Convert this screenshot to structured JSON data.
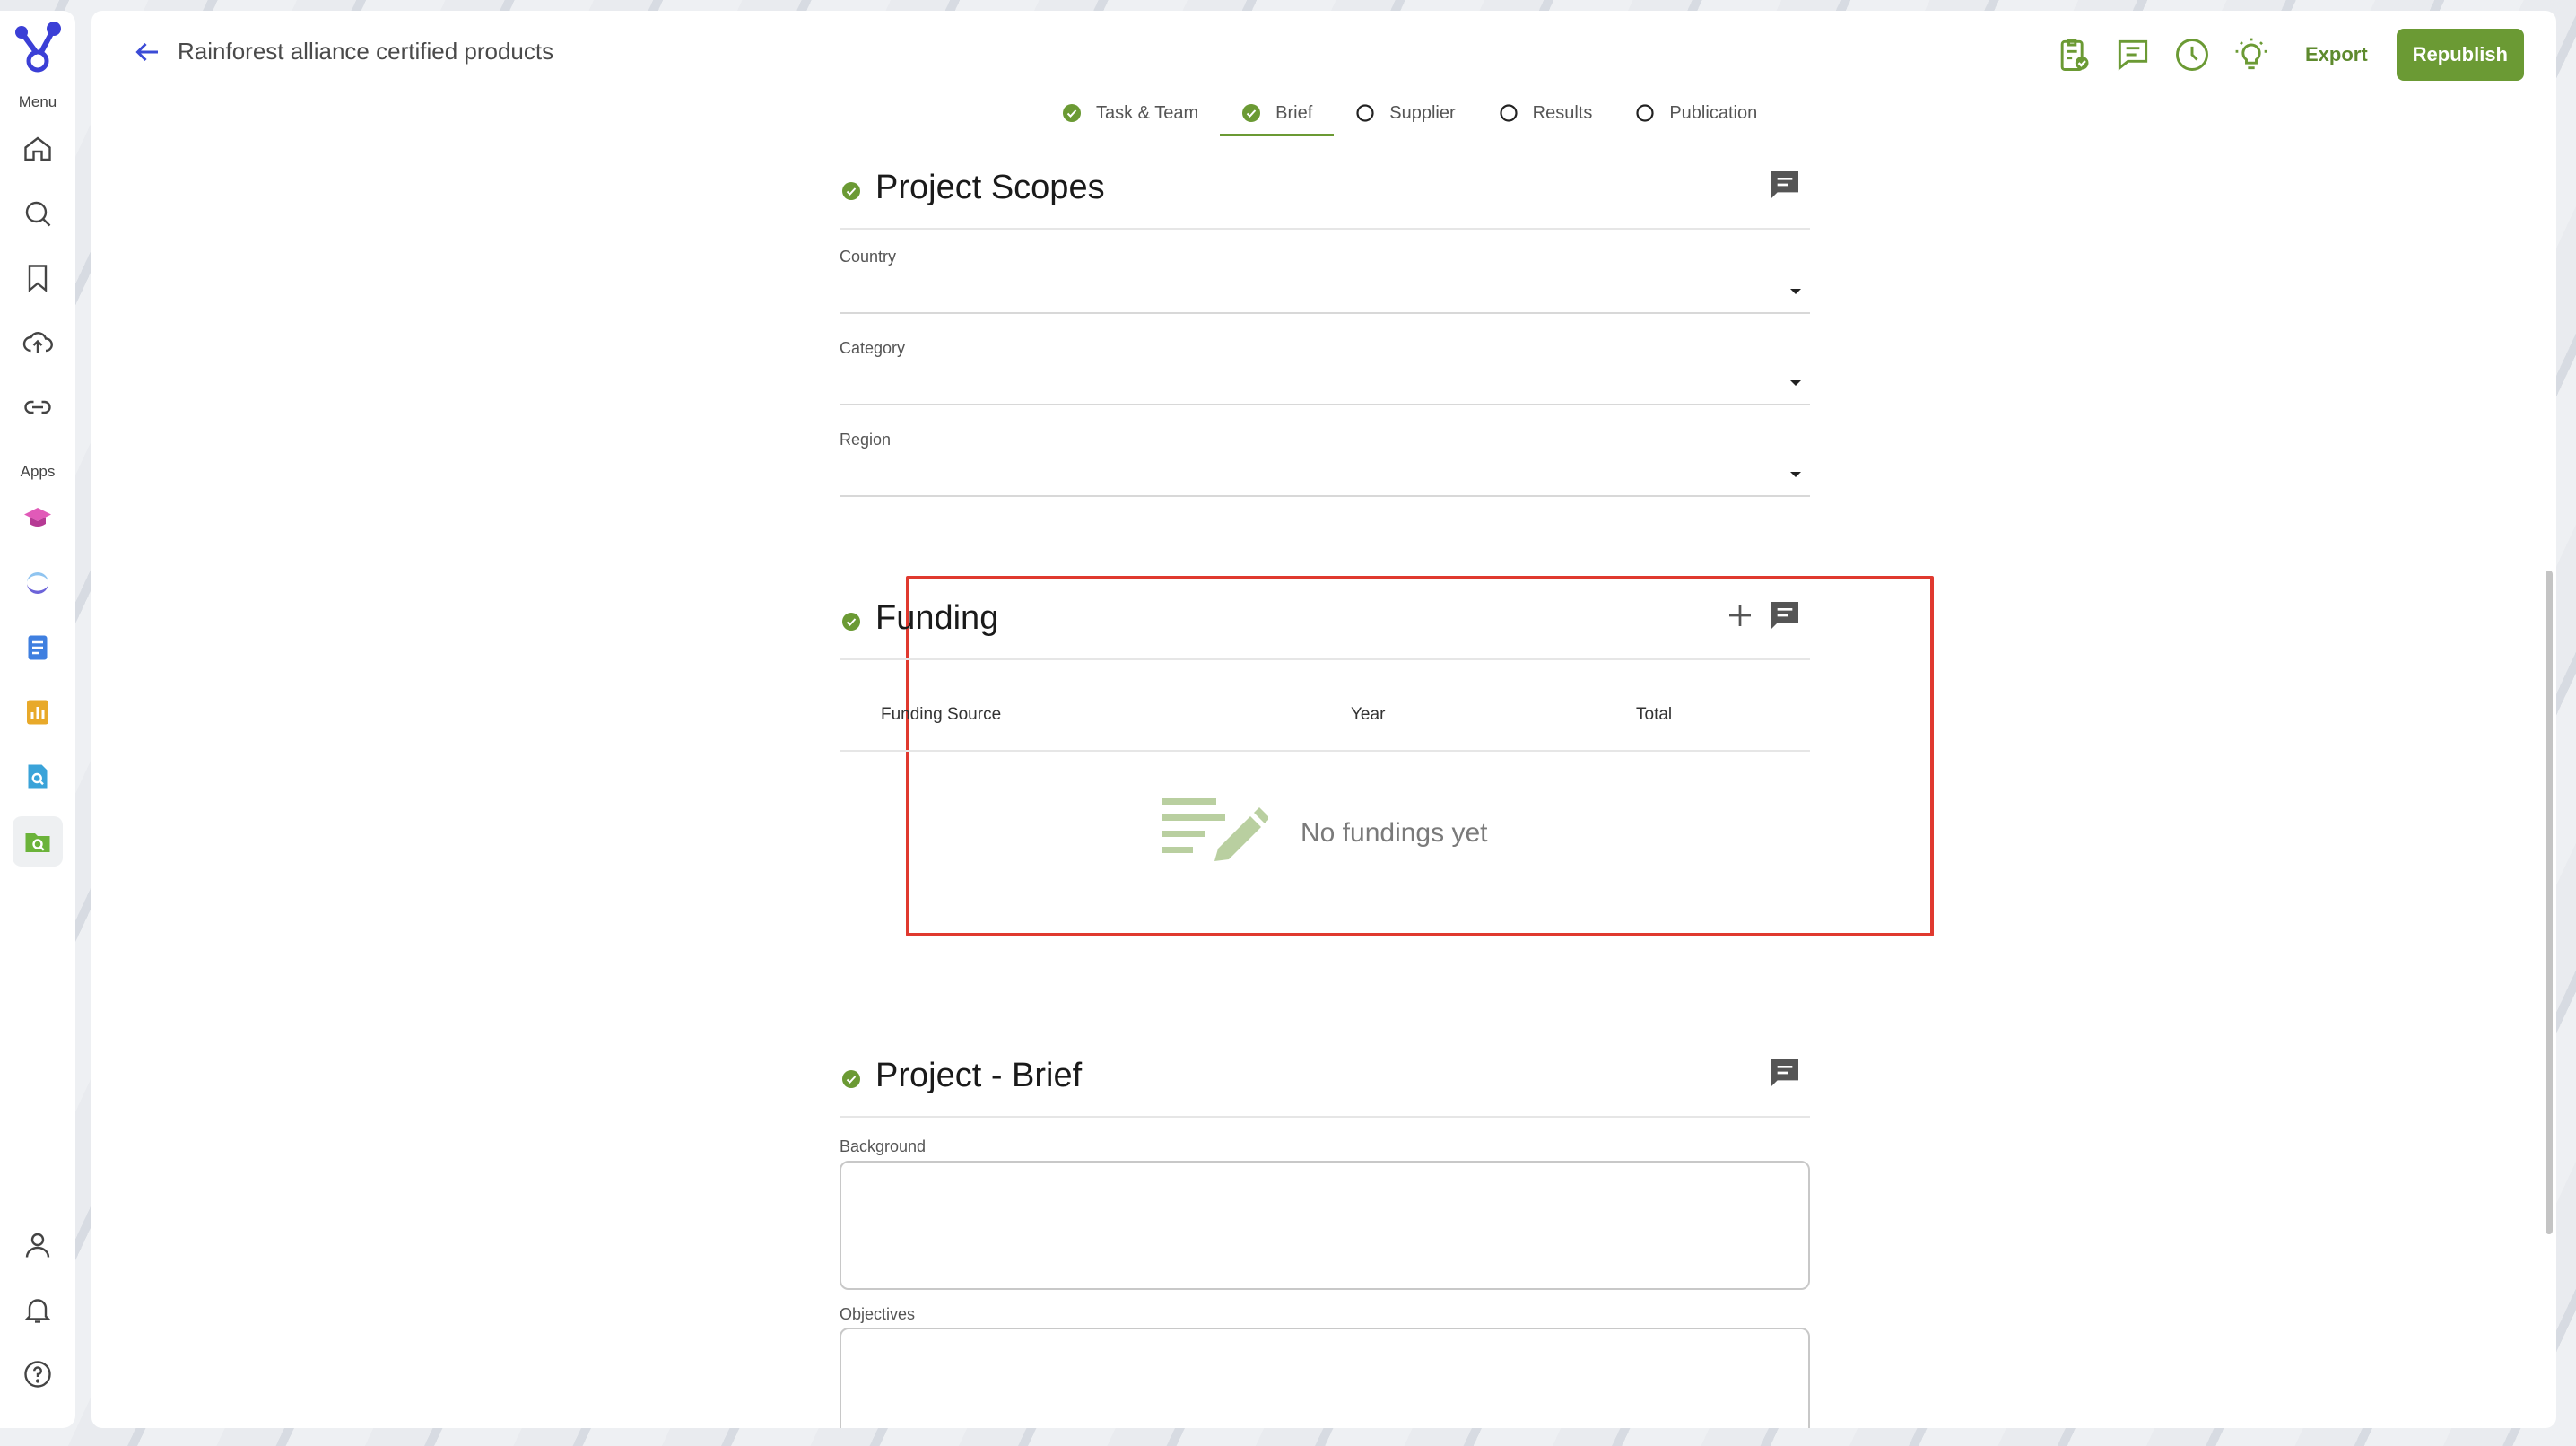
{
  "sidebar": {
    "menu_label": "Menu",
    "apps_label": "Apps",
    "menu_items": [
      {
        "icon": "home-icon"
      },
      {
        "icon": "search-icon"
      },
      {
        "icon": "bookmark-icon"
      },
      {
        "icon": "upload-cloud-icon"
      },
      {
        "icon": "link-icon"
      }
    ],
    "apps": [
      {
        "icon": "graduation-cap-app-icon",
        "color": "#d94fb5"
      },
      {
        "icon": "moon-app-icon",
        "color": "#5b7fe0"
      },
      {
        "icon": "document-app-icon",
        "color": "#3f7fe0"
      },
      {
        "icon": "bar-chart-app-icon",
        "color": "#e0a52a"
      },
      {
        "icon": "doc-search-app-icon",
        "color": "#3aa3d9"
      },
      {
        "icon": "folder-search-app-icon",
        "color": "#6bb33a"
      }
    ],
    "bottom_items": [
      {
        "icon": "user-icon"
      },
      {
        "icon": "bell-icon"
      },
      {
        "icon": "help-icon"
      }
    ]
  },
  "header": {
    "title": "Rainforest alliance certified products",
    "export_label": "Export",
    "republish_label": "Republish",
    "accent_color": "#6b9a34"
  },
  "stepper": {
    "steps": [
      {
        "label": "Task & Team",
        "done": true
      },
      {
        "label": "Brief",
        "done": true,
        "active": true
      },
      {
        "label": "Supplier",
        "done": false
      },
      {
        "label": "Results",
        "done": false
      },
      {
        "label": "Publication",
        "done": false
      }
    ]
  },
  "project_scopes": {
    "title": "Project Scopes",
    "fields": [
      {
        "label": "Country",
        "value": ""
      },
      {
        "label": "Category",
        "value": ""
      },
      {
        "label": "Region",
        "value": ""
      }
    ]
  },
  "funding": {
    "title": "Funding",
    "columns": [
      "Funding Source",
      "Year",
      "Total"
    ],
    "empty_message": "No fundings yet",
    "highlight_color": "#e0392f"
  },
  "project_brief": {
    "title": "Project - Brief",
    "background_label": "Background",
    "objectives_label": "Objectives"
  }
}
